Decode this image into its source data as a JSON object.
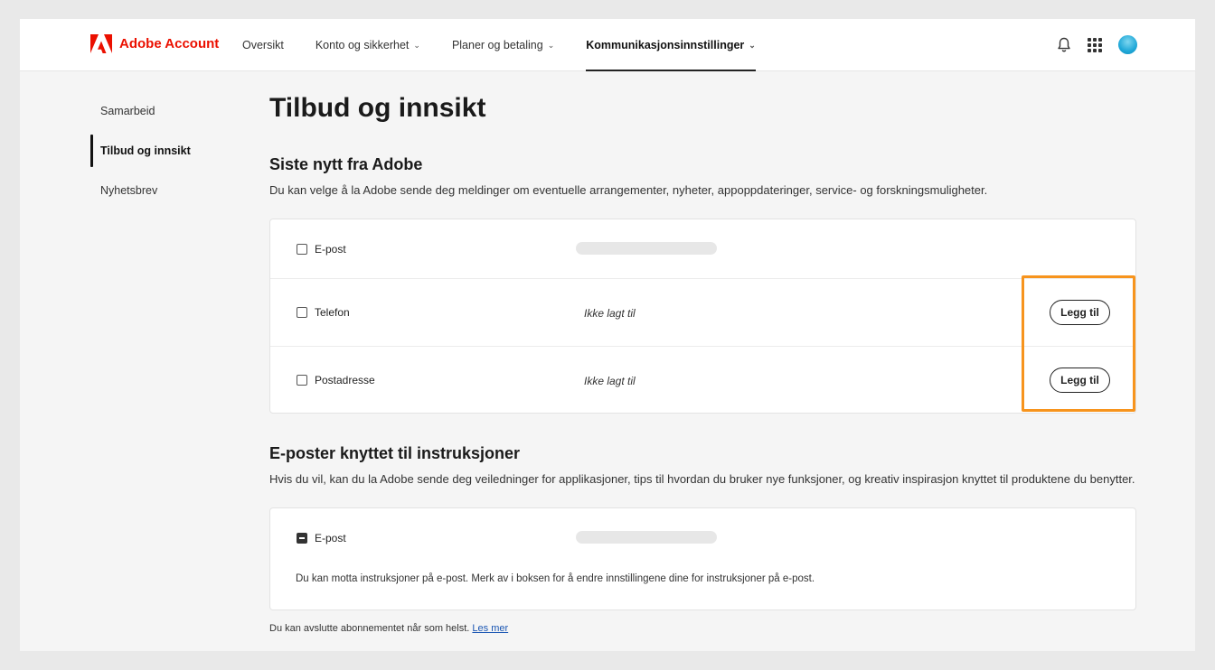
{
  "header": {
    "brand": "Adobe Account",
    "nav": [
      {
        "label": "Oversikt",
        "chevron": false,
        "active": false
      },
      {
        "label": "Konto og sikkerhet",
        "chevron": true,
        "active": false
      },
      {
        "label": "Planer og betaling",
        "chevron": true,
        "active": false
      },
      {
        "label": "Kommunikasjonsinnstillinger",
        "chevron": true,
        "active": true
      }
    ],
    "icons": [
      "bell-icon",
      "apps-grid-icon",
      "avatar"
    ]
  },
  "sidebar": {
    "items": [
      {
        "label": "Samarbeid",
        "active": false
      },
      {
        "label": "Tilbud og innsikt",
        "active": true
      },
      {
        "label": "Nyhetsbrev",
        "active": false
      }
    ]
  },
  "main": {
    "title": "Tilbud og innsikt",
    "section1": {
      "title": "Siste nytt fra Adobe",
      "description": "Du kan velge å la Adobe sende deg meldinger om eventuelle arrangementer, nyheter, appoppdateringer, service- og forskningsmuligheter.",
      "rows": [
        {
          "label": "E-post",
          "status": "",
          "button": ""
        },
        {
          "label": "Telefon",
          "status": "Ikke lagt til",
          "button": "Legg til"
        },
        {
          "label": "Postadresse",
          "status": "Ikke lagt til",
          "button": "Legg til"
        }
      ]
    },
    "section2": {
      "title": "E-poster knyttet til instruksjoner",
      "description": "Hvis du vil, kan du la Adobe sende deg veiledninger for applikasjoner, tips til hvordan du bruker nye funksjoner, og kreativ inspirasjon knyttet til produktene du benytter.",
      "row_label": "E-post",
      "note": "Du kan motta instruksjoner på e-post. Merk av i boksen for å endre innstillingene dine for instruksjoner på e-post."
    },
    "footer": {
      "text": "Du kan avslutte abonnementet når som helst.",
      "link": "Les mer"
    }
  },
  "colors": {
    "brand_red": "#eb1000",
    "highlight_orange": "#f7941d",
    "link_blue": "#1a56b3"
  }
}
